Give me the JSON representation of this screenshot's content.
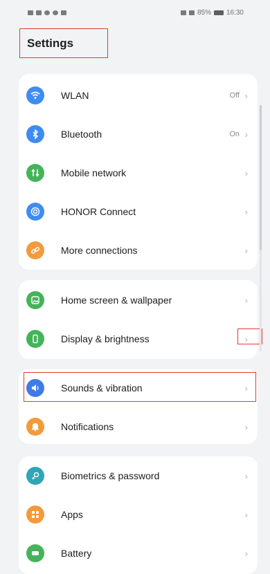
{
  "status_bar": {
    "time": "16:30",
    "battery": "85%"
  },
  "header": {
    "title": "Settings"
  },
  "groups": [
    {
      "items": [
        {
          "label": "WLAN",
          "value": "Off",
          "icon": "wifi-icon",
          "color": "#3f8cf0"
        },
        {
          "label": "Bluetooth",
          "value": "On",
          "icon": "bluetooth-icon",
          "color": "#3f8cf0"
        },
        {
          "label": "Mobile network",
          "value": "",
          "icon": "mobile-network-icon",
          "color": "#45b35a"
        },
        {
          "label": "HONOR Connect",
          "value": "",
          "icon": "honor-connect-icon",
          "color": "#3f8cf0"
        },
        {
          "label": "More connections",
          "value": "",
          "icon": "link-icon",
          "color": "#f39a3b"
        }
      ]
    },
    {
      "items": [
        {
          "label": "Home screen & wallpaper",
          "value": "",
          "icon": "image-icon",
          "color": "#45b35a"
        },
        {
          "label": "Display & brightness",
          "value": "",
          "icon": "display-icon",
          "color": "#45b35a"
        }
      ]
    },
    {
      "items": [
        {
          "label": "Sounds & vibration",
          "value": "",
          "icon": "speaker-icon",
          "color": "#3f7be8"
        },
        {
          "label": "Notifications",
          "value": "",
          "icon": "bell-icon",
          "color": "#f39a3b"
        }
      ]
    },
    {
      "items": [
        {
          "label": "Biometrics & password",
          "value": "",
          "icon": "key-icon",
          "color": "#2fa6b8"
        },
        {
          "label": "Apps",
          "value": "",
          "icon": "apps-grid-icon",
          "color": "#f39a3b"
        },
        {
          "label": "Battery",
          "value": "",
          "icon": "battery-icon",
          "color": "#45b35a"
        }
      ]
    }
  ],
  "chevron": "›"
}
